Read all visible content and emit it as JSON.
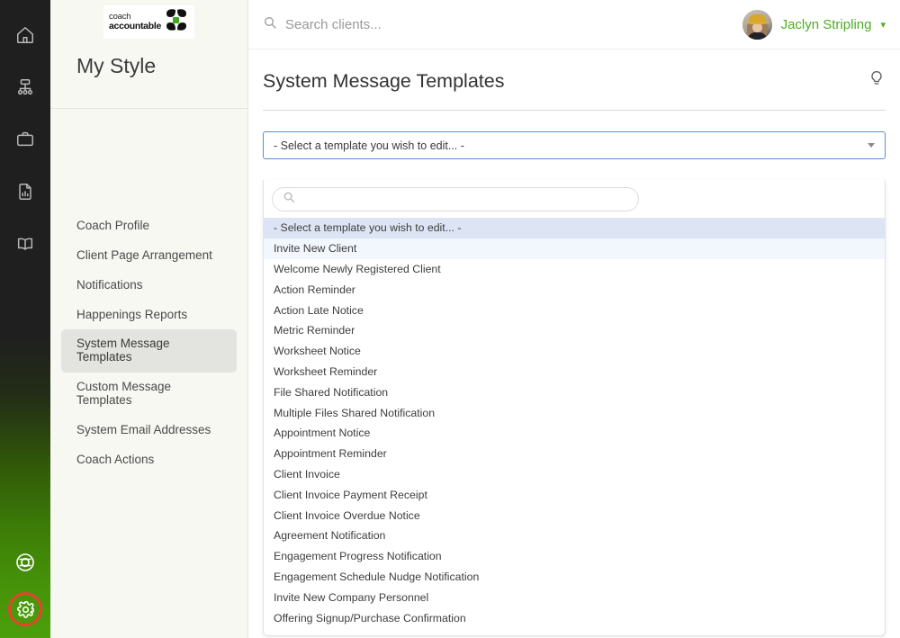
{
  "rail": {
    "top_icons": [
      {
        "name": "home-icon"
      },
      {
        "name": "org-chart-icon"
      },
      {
        "name": "briefcase-icon"
      },
      {
        "name": "report-document-icon"
      },
      {
        "name": "book-icon"
      }
    ],
    "bottom_icons": [
      {
        "name": "lifebuoy-icon"
      },
      {
        "name": "gear-icon"
      }
    ],
    "accent_highlight": "#e8422e",
    "gradient_from": "#1f1f1f",
    "gradient_to": "#4ba00b"
  },
  "sidebar": {
    "logo": {
      "line1": "coach",
      "line2": "accountable",
      "leaf_color": "#3faa1e"
    },
    "title": "My Style",
    "items": [
      {
        "label": "Coach Profile",
        "active": false
      },
      {
        "label": "Client Page Arrangement",
        "active": false
      },
      {
        "label": "Notifications",
        "active": false
      },
      {
        "label": "Happenings Reports",
        "active": false
      },
      {
        "label": "System Message Templates",
        "active": true
      },
      {
        "label": "Custom Message Templates",
        "active": false
      },
      {
        "label": "System Email Addresses",
        "active": false
      },
      {
        "label": "Coach Actions",
        "active": false
      }
    ]
  },
  "topbar": {
    "search_placeholder": "Search clients...",
    "user_name": "Jaclyn Stripling",
    "user_name_color": "#4caf1f"
  },
  "page": {
    "title": "System Message Templates",
    "help_icon": "lightbulb-icon"
  },
  "select": {
    "value": "- Select a template you wish to edit... -",
    "focus_color": "#5a8dd6",
    "search_placeholder": "",
    "options": [
      {
        "label": "- Select a template you wish to edit... -",
        "state": "selected"
      },
      {
        "label": "Invite New Client",
        "state": "hover"
      },
      {
        "label": "Welcome Newly Registered Client",
        "state": ""
      },
      {
        "label": "Action Reminder",
        "state": ""
      },
      {
        "label": "Action Late Notice",
        "state": ""
      },
      {
        "label": "Metric Reminder",
        "state": ""
      },
      {
        "label": "Worksheet Notice",
        "state": ""
      },
      {
        "label": "Worksheet Reminder",
        "state": ""
      },
      {
        "label": "File Shared Notification",
        "state": ""
      },
      {
        "label": "Multiple Files Shared Notification",
        "state": ""
      },
      {
        "label": "Appointment Notice",
        "state": ""
      },
      {
        "label": "Appointment Reminder",
        "state": ""
      },
      {
        "label": "Client Invoice",
        "state": ""
      },
      {
        "label": "Client Invoice Payment Receipt",
        "state": ""
      },
      {
        "label": "Client Invoice Overdue Notice",
        "state": ""
      },
      {
        "label": "Agreement Notification",
        "state": ""
      },
      {
        "label": "Engagement Progress Notification",
        "state": ""
      },
      {
        "label": "Engagement Schedule Nudge Notification",
        "state": ""
      },
      {
        "label": "Invite New Company Personnel",
        "state": ""
      },
      {
        "label": "Offering Signup/Purchase Confirmation",
        "state": ""
      }
    ]
  }
}
